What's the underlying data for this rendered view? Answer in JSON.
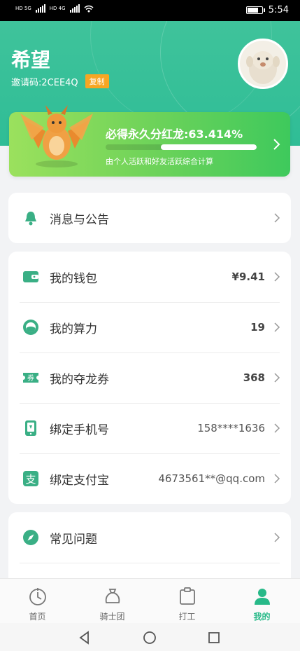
{
  "status_bar": {
    "time": "5:54",
    "sim1": "HD 5G",
    "sim2": "HD 4G"
  },
  "profile": {
    "username": "希望",
    "invite_code_text": "邀请码:2CEE4Q",
    "copy_label": "复制"
  },
  "dividend": {
    "title": "必得永久分红龙:63.414%",
    "progress_fraction": 0.63414,
    "subtitle": "由个人活跃和好友活跃综合计算"
  },
  "notice": {
    "label": "消息与公告",
    "icon": "bell-icon"
  },
  "account": {
    "items": [
      {
        "label": "我的钱包",
        "value": "¥9.41",
        "icon": "wallet-icon"
      },
      {
        "label": "我的算力",
        "value": "19",
        "icon": "power-icon"
      },
      {
        "label": "我的夺龙券",
        "value": "368",
        "icon": "ticket-icon"
      },
      {
        "label": "绑定手机号",
        "value": "158****1636",
        "icon": "phone-icon"
      },
      {
        "label": "绑定支付宝",
        "value": "4673561**@qq.com",
        "icon": "alipay-icon"
      }
    ]
  },
  "help": {
    "label": "常见问题",
    "icon": "compass-icon"
  },
  "tabs": [
    {
      "label": "首页",
      "icon": "home-icon",
      "active": false
    },
    {
      "label": "骑士团",
      "icon": "bag-icon",
      "active": false
    },
    {
      "label": "打工",
      "icon": "clipboard-icon",
      "active": false
    },
    {
      "label": "我的",
      "icon": "user-icon",
      "active": true
    }
  ],
  "colors": {
    "primary": "#27b988",
    "header": "#3fc39b",
    "copy_badge": "#f6a623",
    "banner_start": "#9be15d",
    "banner_end": "#3ec95c"
  }
}
